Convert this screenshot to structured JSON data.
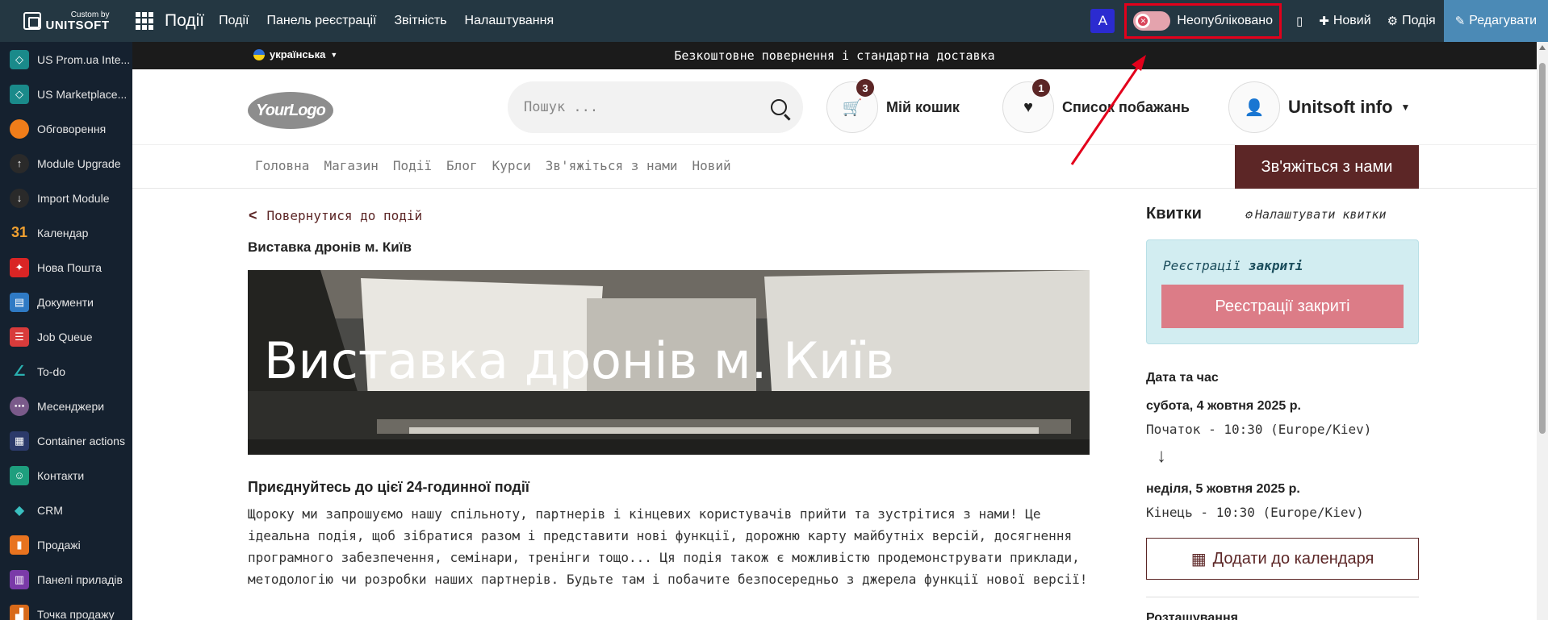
{
  "topbar": {
    "brand_small": "Custom by",
    "brand_big": "UNITSOFT",
    "app_name": "Події",
    "menu": [
      "Події",
      "Панель реєстрації",
      "Звітність",
      "Налаштування"
    ],
    "avatar_letter": "A",
    "publish_status": "Неопубліковано",
    "new_label": "Новий",
    "event_label": "Подія",
    "edit_label": "Редагувати"
  },
  "sidebar": {
    "items": [
      {
        "label": "US Prom.ua Inte...",
        "icon": "cube-icon",
        "color": "#1a8a8a"
      },
      {
        "label": "US Marketplace...",
        "icon": "cube-icon",
        "color": "#1a8a8a"
      },
      {
        "label": "Обговорення",
        "icon": "chat-icon",
        "color": "#f07d1a"
      },
      {
        "label": "Module Upgrade",
        "icon": "upgrade-icon",
        "color": "#2a2a2a"
      },
      {
        "label": "Import Module",
        "icon": "import-icon",
        "color": "#2a2a2a"
      },
      {
        "label": "Календар",
        "icon": "calendar-icon",
        "color": "#15212f"
      },
      {
        "label": "Нова Пошта",
        "icon": "nova-poshta-icon",
        "color": "#d92525"
      },
      {
        "label": "Документи",
        "icon": "documents-icon",
        "color": "#2f7ac4"
      },
      {
        "label": "Job Queue",
        "icon": "list-icon",
        "color": "#d83b3b"
      },
      {
        "label": "To-do",
        "icon": "todo-icon",
        "color": "#15212f"
      },
      {
        "label": "Месенджери",
        "icon": "messenger-icon",
        "color": "#7a5a8a"
      },
      {
        "label": "Container actions",
        "icon": "container-icon",
        "color": "#2c3a6a"
      },
      {
        "label": "Контакти",
        "icon": "contacts-icon",
        "color": "#1e9e7e"
      },
      {
        "label": "CRM",
        "icon": "crm-icon",
        "color": "#15212f"
      },
      {
        "label": "Продажі",
        "icon": "sales-icon",
        "color": "#e8731f"
      },
      {
        "label": "Панелі приладів",
        "icon": "dashboard-icon",
        "color": "#7a3aa8"
      },
      {
        "label": "Точка продажу",
        "icon": "pos-icon",
        "color": "#d86a1a"
      }
    ]
  },
  "site": {
    "announcement": "Безкоштовне повернення і стандартна доставка",
    "language": "українська",
    "logo_text": "YourLogo",
    "search_placeholder": "Пошук ...",
    "cart": {
      "label": "Мій кошик",
      "count": "3"
    },
    "wishlist": {
      "label": "Список побажань",
      "count": "1"
    },
    "user": {
      "label": "Unitsoft info"
    },
    "nav": [
      "Головна",
      "Магазин",
      "Події",
      "Блог",
      "Курси",
      "Зв'яжіться з нами",
      "Новий"
    ],
    "nav_cta": "Зв'яжіться з нами",
    "back_label": "Повернутися до подій",
    "event_title": "Виставка дронів м. Київ",
    "banner_title": "Виставка дронів м. Київ",
    "join_title": "Приєднуйтесь до цієї 24-годинної події",
    "description": "Щороку ми запрошуємо нашу спільноту, партнерів і кінцевих користувачів прийти та зустрітися з нами! Це ідеальна подія, щоб зібратися разом і представити нові функції, дорожню карту майбутніх версій, досягнення програмного забезпечення, семінари, тренінги тощо... Ця подія також є можливістю продемонструвати приклади, методологію чи розробки наших партнерів. Будьте там і побачите безпосередньо з джерела функції нової версії!",
    "tickets": {
      "title": "Квитки",
      "configure": "Налаштувати квитки",
      "status_prefix": "Реєстрації ",
      "status_value": "закриті",
      "button": "Реєстрації закриті"
    },
    "datetime": {
      "label": "Дата та час",
      "start_date": "субота, 4 жовтня 2025 р.",
      "start": "Початок - 10:30 (Europe/Kiev)",
      "end_date": "неділя, 5 жовтня 2025 р.",
      "end": "Кінець - 10:30 (Europe/Kiev)"
    },
    "add_calendar": "Додати до календаря",
    "location_label": "Розташування"
  },
  "colors": {
    "topbar": "#243742",
    "sidebar": "#15212f",
    "brand": "#5c2626",
    "highlight": "#e3001b",
    "edit": "#4b8ab6"
  }
}
